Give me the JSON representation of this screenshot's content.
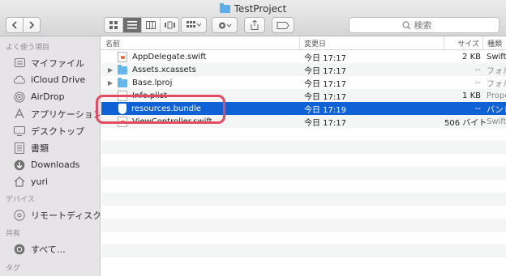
{
  "window": {
    "title": "TestProject"
  },
  "search": {
    "placeholder": "検索"
  },
  "sidebar": {
    "favorites_label": "よく使う項目",
    "favorites": [
      {
        "label": "マイファイル",
        "icon": "my-files-icon"
      },
      {
        "label": "iCloud Drive",
        "icon": "cloud-icon"
      },
      {
        "label": "AirDrop",
        "icon": "airdrop-icon"
      },
      {
        "label": "アプリケーション",
        "icon": "applications-icon"
      },
      {
        "label": "デスクトップ",
        "icon": "desktop-icon"
      },
      {
        "label": "書類",
        "icon": "documents-icon"
      },
      {
        "label": "Downloads",
        "icon": "downloads-icon"
      },
      {
        "label": "yuri",
        "icon": "home-icon"
      }
    ],
    "devices_label": "デバイス",
    "devices": [
      {
        "label": "リモートディスク",
        "icon": "remote-disc-icon"
      }
    ],
    "shared_label": "共有",
    "shared": [
      {
        "label": "すべて…",
        "icon": "network-icon"
      }
    ],
    "tags_label": "タグ"
  },
  "columns": {
    "name": "名前",
    "date": "変更日",
    "size": "サイズ",
    "kind": "種類"
  },
  "files": [
    {
      "name": "AppDelegate.swift",
      "date": "今日 17:17",
      "size": "2 KB",
      "kind": "Swift",
      "type": "swift"
    },
    {
      "name": "Assets.xcassets",
      "date": "今日 17:17",
      "size": "--",
      "kind": "フォル",
      "type": "folder"
    },
    {
      "name": "Base.lproj",
      "date": "今日 17:17",
      "size": "--",
      "kind": "フォル",
      "type": "folder"
    },
    {
      "name": "Info.plist",
      "date": "今日 17:17",
      "size": "1 KB",
      "kind": "Prope",
      "type": "doc"
    },
    {
      "name": "resources.bundle",
      "date": "今日 17:19",
      "size": "--",
      "kind": "バンド",
      "type": "bundle"
    },
    {
      "name": "ViewController.swift",
      "date": "今日 17:17",
      "size": "506 バイト",
      "kind": "Swift",
      "type": "swift"
    }
  ],
  "colors": {
    "selection": "#0f62d6",
    "highlight": "#e34b62",
    "folder": "#63b6ee"
  }
}
